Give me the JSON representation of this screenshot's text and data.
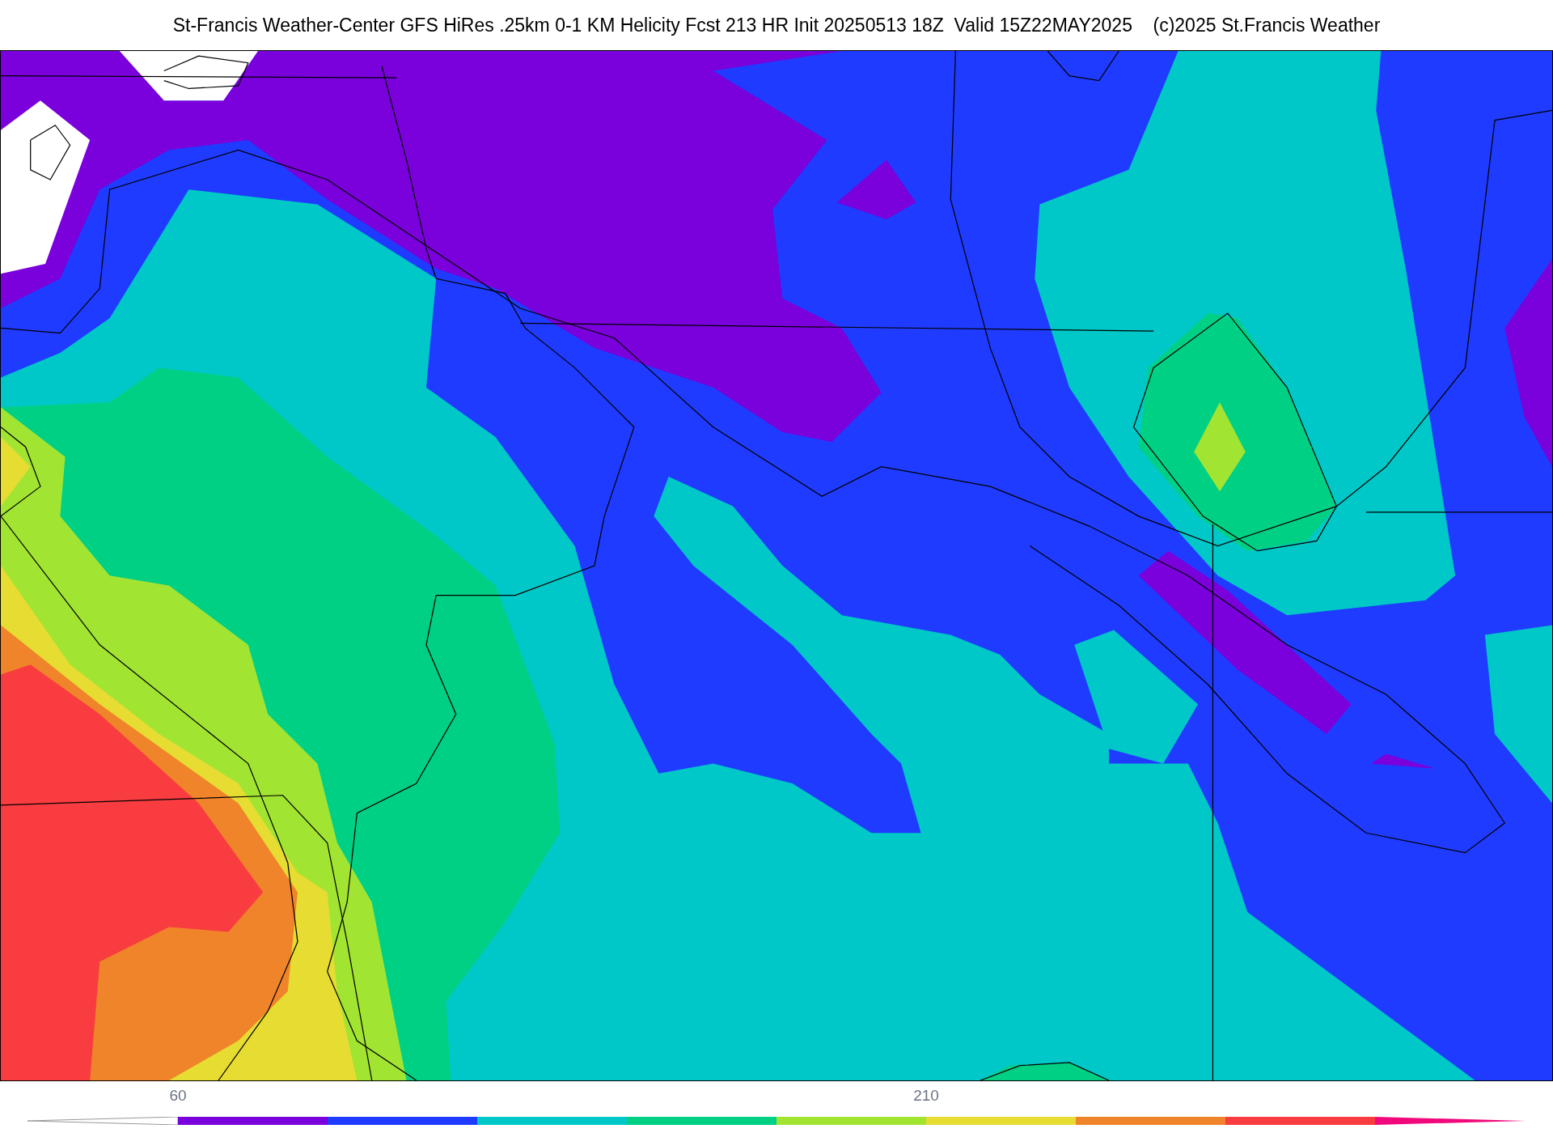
{
  "title": "St-Francis Weather-Center GFS HiRes .25km 0-1 KM Helicity Fcst 213 HR Init 20250513 18Z  Valid 15Z22MAY2025    (c)2025 St.Francis Weather",
  "colorbar": {
    "segments": [
      {
        "color": "#7a00dc",
        "label": "60"
      },
      {
        "color": "#1f3bff"
      },
      {
        "color": "#00c8c8"
      },
      {
        "color": "#00d084"
      },
      {
        "color": "#a2e432"
      },
      {
        "color": "#e6dc32",
        "label": "210"
      },
      {
        "color": "#f0842a"
      },
      {
        "color": "#f83c40"
      }
    ]
  }
}
